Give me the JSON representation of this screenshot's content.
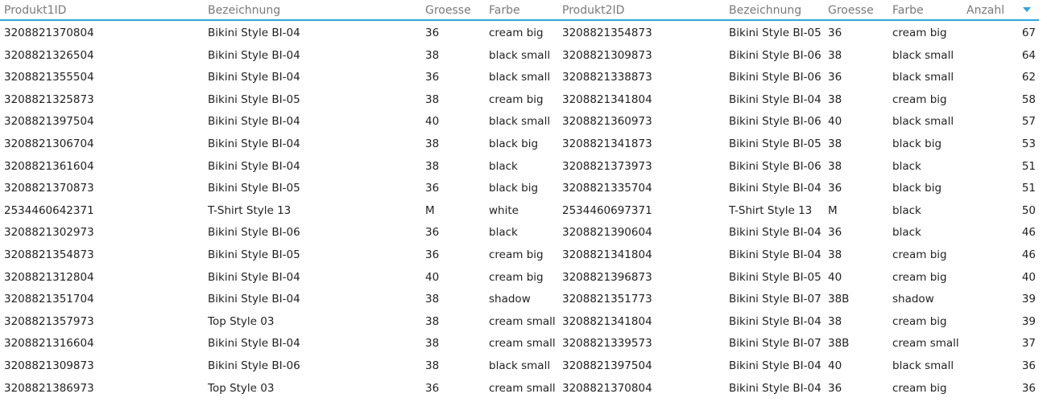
{
  "table": {
    "columns": [
      "Produkt1ID",
      "Bezeichnung",
      "Groesse",
      "Farbe",
      "Produkt2ID",
      "Bezeichnung",
      "Groesse",
      "Farbe",
      "Anzahl"
    ],
    "sort": {
      "column": "Anzahl",
      "direction": "descending",
      "icon": "sort-desc-triangle-icon",
      "color": "#2ca8e0"
    },
    "rows": [
      [
        "3208821370804",
        "Bikini Style BI-04",
        "36",
        "cream big",
        "3208821354873",
        "Bikini Style BI-05",
        "36",
        "cream big",
        "67"
      ],
      [
        "3208821326504",
        "Bikini Style BI-04",
        "38",
        "black small",
        "3208821309873",
        "Bikini Style BI-06",
        "38",
        "black small",
        "64"
      ],
      [
        "3208821355504",
        "Bikini Style BI-04",
        "36",
        "black small",
        "3208821338873",
        "Bikini Style BI-06",
        "36",
        "black small",
        "62"
      ],
      [
        "3208821325873",
        "Bikini Style BI-05",
        "38",
        "cream big",
        "3208821341804",
        "Bikini Style BI-04",
        "38",
        "cream big",
        "58"
      ],
      [
        "3208821397504",
        "Bikini Style BI-04",
        "40",
        "black small",
        "3208821360973",
        "Bikini Style BI-06",
        "40",
        "black small",
        "57"
      ],
      [
        "3208821306704",
        "Bikini Style BI-04",
        "38",
        "black big",
        "3208821341873",
        "Bikini Style BI-05",
        "38",
        "black big",
        "53"
      ],
      [
        "3208821361604",
        "Bikini Style BI-04",
        "38",
        "black",
        "3208821373973",
        "Bikini Style BI-06",
        "38",
        "black",
        "51"
      ],
      [
        "3208821370873",
        "Bikini Style BI-05",
        "36",
        "black big",
        "3208821335704",
        "Bikini Style BI-04",
        "36",
        "black big",
        "51"
      ],
      [
        "2534460642371",
        "T-Shirt Style 13",
        "M",
        "white",
        "2534460697371",
        "T-Shirt Style 13",
        "M",
        "black",
        "50"
      ],
      [
        "3208821302973",
        "Bikini Style BI-06",
        "36",
        "black",
        "3208821390604",
        "Bikini Style BI-04",
        "36",
        "black",
        "46"
      ],
      [
        "3208821354873",
        "Bikini Style BI-05",
        "36",
        "cream big",
        "3208821341804",
        "Bikini Style BI-04",
        "38",
        "cream big",
        "46"
      ],
      [
        "3208821312804",
        "Bikini Style BI-04",
        "40",
        "cream big",
        "3208821396873",
        "Bikini Style BI-05",
        "40",
        "cream big",
        "40"
      ],
      [
        "3208821351704",
        "Bikini Style BI-04",
        "38",
        "shadow",
        "3208821351773",
        "Bikini Style BI-07",
        "38B",
        "shadow",
        "39"
      ],
      [
        "3208821357973",
        "Top Style 03",
        "38",
        "cream small",
        "3208821341804",
        "Bikini Style BI-04",
        "38",
        "cream big",
        "39"
      ],
      [
        "3208821316604",
        "Bikini Style BI-04",
        "38",
        "cream small",
        "3208821339573",
        "Bikini Style BI-07",
        "38B",
        "cream small",
        "37"
      ],
      [
        "3208821309873",
        "Bikini Style BI-06",
        "38",
        "black small",
        "3208821397504",
        "Bikini Style BI-04",
        "40",
        "black small",
        "36"
      ],
      [
        "3208821386973",
        "Top Style 03",
        "36",
        "cream small",
        "3208821370804",
        "Bikini Style BI-04",
        "36",
        "cream big",
        "36"
      ]
    ]
  }
}
